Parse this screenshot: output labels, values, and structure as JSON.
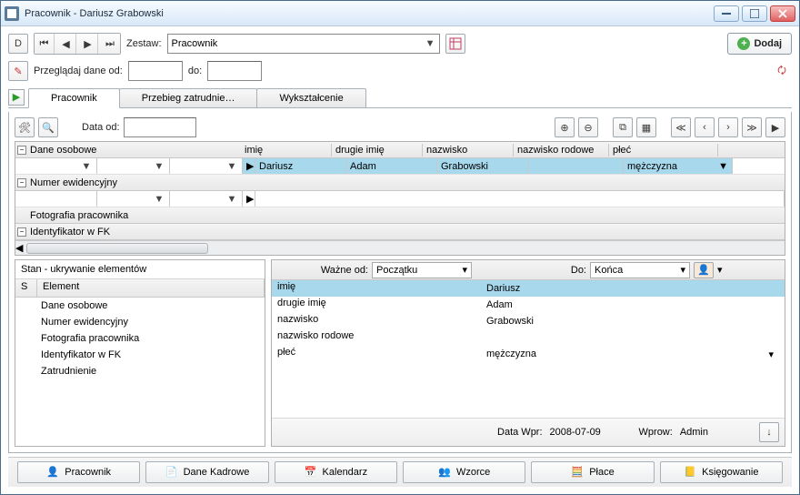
{
  "window": {
    "title": "Pracownik - Dariusz Grabowski"
  },
  "toolbar": {
    "zestaw_label": "Zestaw:",
    "zestaw_value": "Pracownik",
    "dodaj_label": "Dodaj",
    "przegladaj_label": "Przeglądaj dane od:",
    "do_label": "do:"
  },
  "tabs": {
    "t1": "Pracownik",
    "t2": "Przebieg zatrudnie…",
    "t3": "Wykształcenie"
  },
  "grid": {
    "data_od_label": "Data od:",
    "group_osobowe": "Dane osobowe",
    "group_numer": "Numer ewidencyjny",
    "group_foto": "Fotografia pracownika",
    "group_ident": "Identyfikator w FK",
    "col_imie": "imię",
    "col_drugie": "drugie imię",
    "col_nazwisko": "nazwisko",
    "col_rodowe": "nazwisko rodowe",
    "col_plec": "płeć",
    "val_imie": "Dariusz",
    "val_drugie": "Adam",
    "val_nazwisko": "Grabowski",
    "val_rodowe": "",
    "val_plec": "mężczyzna"
  },
  "left": {
    "title": "Stan - ukrywanie elementów",
    "col_s": "S",
    "col_el": "Element",
    "items": [
      "Dane osobowe",
      "Numer ewidencyjny",
      "Fotografia pracownika",
      "Identyfikator w FK",
      "Zatrudnienie"
    ]
  },
  "right": {
    "wazne_od_label": "Ważne od:",
    "wazne_od_value": "Początku",
    "do_label": "Do:",
    "do_value": "Końca",
    "rows": [
      {
        "k": "imię",
        "v": "Dariusz"
      },
      {
        "k": "drugie imię",
        "v": "Adam"
      },
      {
        "k": "nazwisko",
        "v": "Grabowski"
      },
      {
        "k": "nazwisko rodowe",
        "v": ""
      },
      {
        "k": "płeć",
        "v": "mężczyzna"
      }
    ]
  },
  "footer": {
    "data_wpr_label": "Data Wpr:",
    "data_wpr_value": "2008-07-09",
    "wprow_label": "Wprow:",
    "wprow_value": "Admin"
  },
  "apptabs": {
    "t1": "Pracownik",
    "t2": "Dane Kadrowe",
    "t3": "Kalendarz",
    "t4": "Wzorce",
    "t5": "Płace",
    "t6": "Księgowanie"
  }
}
